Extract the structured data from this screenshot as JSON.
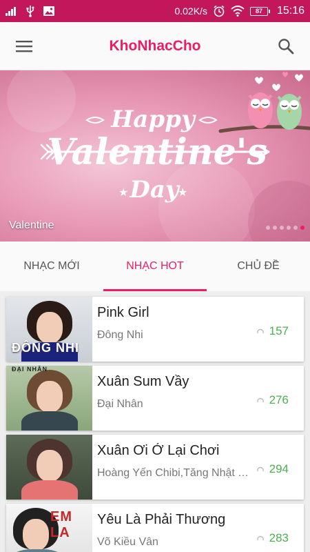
{
  "status_bar": {
    "speed": "0.02K/s",
    "battery": "87",
    "time": "15:16"
  },
  "app_bar": {
    "title": "KhoNhacCho"
  },
  "banner": {
    "caption": "Valentine",
    "art_line1": "Happy",
    "art_line2": "Valentine's",
    "art_line3": "Day",
    "slide_count": 6,
    "active_slide": 6
  },
  "tabs": [
    {
      "label": "NHẠC MỚI",
      "active": false
    },
    {
      "label": "NHẠC HOT",
      "active": true
    },
    {
      "label": "CHỦ ĐỀ",
      "active": false
    }
  ],
  "songs": [
    {
      "title": "Pink Girl",
      "artist": "Đông Nhi",
      "plays": "157"
    },
    {
      "title": "Xuân Sum Vầy",
      "artist": "Đại Nhân",
      "plays": "276"
    },
    {
      "title": "Xuân Ơi Ở Lại Chơi",
      "artist": "Hoàng Yến Chibi,Tăng Nhật Tuệ",
      "plays": "294"
    },
    {
      "title": "Yêu Là Phải Thương",
      "artist": "Võ Kiều Vân",
      "plays": "283"
    }
  ],
  "thumb_texts": {
    "song0": "ĐÔNG NHI",
    "song1": "ĐẠI NHÂN",
    "song3": "EM LA"
  },
  "colors": {
    "accent": "#e91e63",
    "status_bar": "#c2185b",
    "play_count": "#4caf50"
  },
  "icons": {
    "menu": "hamburger-icon",
    "search": "search-icon",
    "plays": "headphones-icon"
  }
}
